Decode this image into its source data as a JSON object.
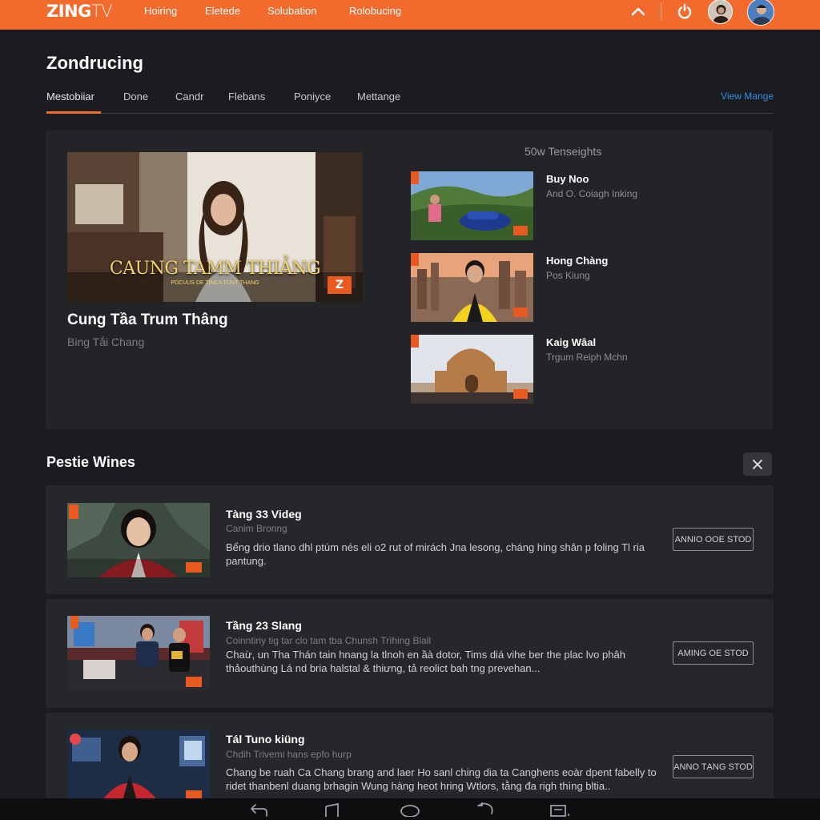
{
  "brand": {
    "logo_main": "ZING",
    "logo_suffix": "TV",
    "accent": "#f36a2d"
  },
  "nav": {
    "items": [
      "Hoiring",
      "Eletede",
      "Solubation",
      "Rolobucing"
    ]
  },
  "page": {
    "title": "Zondrucing"
  },
  "tabs": {
    "items": [
      "Mestobiiar",
      "Done",
      "Candr",
      "Flebans",
      "Poniyce",
      "Mettange"
    ],
    "active_index": 0,
    "view_more": "View Mange"
  },
  "featured": {
    "thumb_caption": "CAUNG TAMM THIẢNG",
    "thumb_subcaption": "PDCUUS DE TINCA TUNT THANG",
    "badge": "Z",
    "title": "Cung Tầa Trum Thâng",
    "subtitle": "Bing Tắi Chang"
  },
  "suggestions": {
    "heading": "50w Tenseights",
    "items": [
      {
        "title": "Buy Noo",
        "subtitle": "And O. Coiagh Inking"
      },
      {
        "title": "Hong Chàng",
        "subtitle": "Pos Kiung"
      },
      {
        "title": "Kaig Wâal",
        "subtitle": "Trgum Reiph Mchn"
      }
    ]
  },
  "list": {
    "heading": "Pestie Wines",
    "items": [
      {
        "title": "Tàng 33 Videg",
        "subtitle": "Canim Bronng",
        "desc": "Bểng drio tlano dhl ptúm nés eli o2 rut of mirách Jna lesong, cháng hing shân p foling Tl ria pantung.",
        "button": "ANNIO OOE STOD"
      },
      {
        "title": "Tầng 23 Slang",
        "subtitle": "Coinntiriy tig tar clo tam tba Chunsh Trìhing Blall",
        "desc": "Chaừ, un Tha Thán tain hnang la tlnoh en ầà dotor, Tims diá vihe ber the plac lvo phâh thảouthùng Lá nd bria halstal & thiưng, tả reolict bah tng prevehan...",
        "button": "AMING OE STOD"
      },
      {
        "title": "Tál Tuno kiüng",
        "subtitle": "Chdih Trivemi hans epfo hurp",
        "desc": "Chang be ruah Ca Chang brang and laer Ho sanl ching dia ta Canghens eoàr dpent fabelly to ridet thanbenl duang brhagin Wung hàng heot hring Wtlors, tằng đa righ thìng bltia..",
        "button": "ANNO TẠNG STOD"
      }
    ]
  }
}
